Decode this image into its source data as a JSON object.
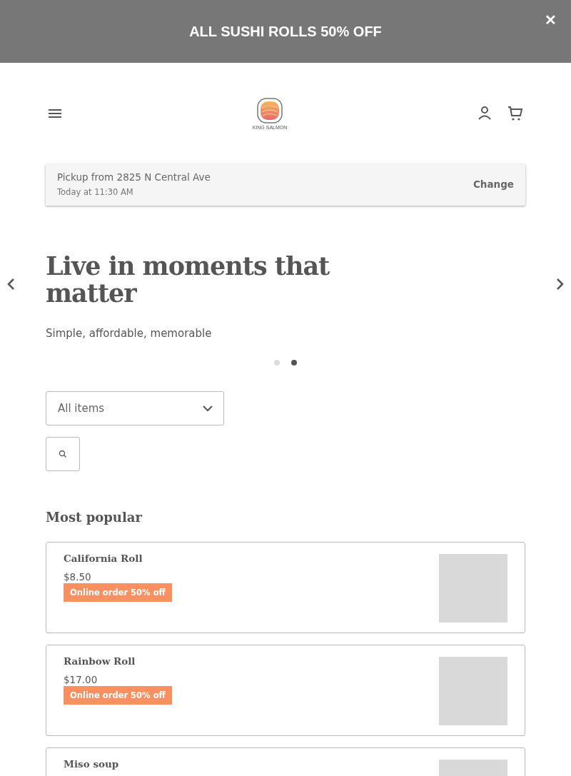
{
  "banner": {
    "text": "ALL SUSHI ROLLS 50% OFF",
    "close": "✕"
  },
  "header": {
    "logo_text": "KING SALMON"
  },
  "pickup": {
    "title": "Pickup from 2825 N Central Ave",
    "time": "Today at 11:30 AM",
    "action": "Change"
  },
  "hero": {
    "title": "Live in moments that matter",
    "subtitle": "Simple, affordable, memorable",
    "dots": [
      {
        "selected": false
      },
      {
        "selected": true
      }
    ]
  },
  "filter": {
    "value": "All items"
  },
  "section": {
    "title": "Most popular"
  },
  "items": [
    {
      "name": "California Roll",
      "price": "$8.50",
      "badge": "Online order 50% off"
    },
    {
      "name": "Rainbow Roll",
      "price": "$17.00",
      "badge": "Online order 50% off"
    },
    {
      "name": "Miso soup"
    }
  ]
}
